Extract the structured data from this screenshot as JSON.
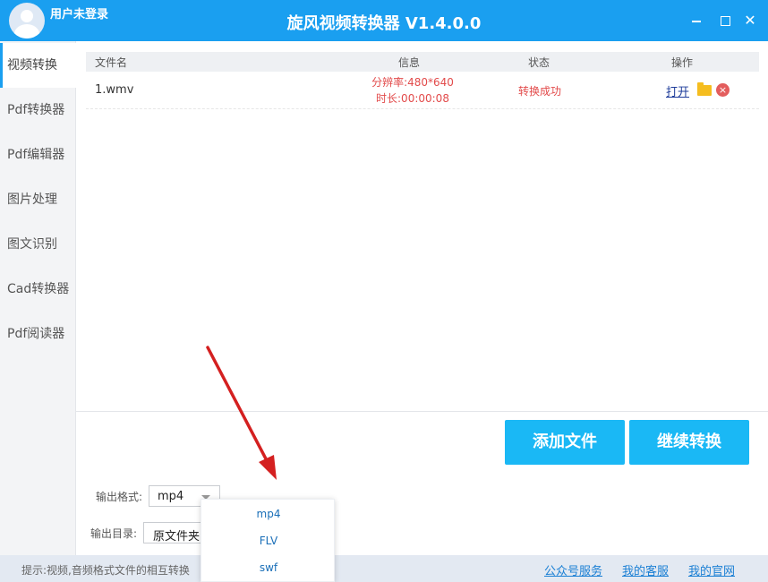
{
  "titlebar": {
    "user_label": "用户未登录",
    "app_title": "旋风视频转换器 V1.4.0.0",
    "close_glyph": "✕"
  },
  "sidebar": {
    "items": [
      {
        "label": "视频转换",
        "active": true
      },
      {
        "label": "Pdf转换器"
      },
      {
        "label": "Pdf编辑器"
      },
      {
        "label": "图片处理"
      },
      {
        "label": "图文识别"
      },
      {
        "label": "Cad转换器"
      },
      {
        "label": "Pdf阅读器"
      }
    ]
  },
  "table": {
    "headers": {
      "name": "文件名",
      "info": "信息",
      "status": "状态",
      "action": "操作"
    },
    "rows": [
      {
        "name": "1.wmv",
        "resolution": "分辨率:480*640",
        "duration": "时长:00:00:08",
        "status": "转换成功",
        "open_label": "打开"
      }
    ]
  },
  "buttons": {
    "add_file": "添加文件",
    "continue": "继续转换"
  },
  "output": {
    "format_label": "输出格式:",
    "format_value": "mp4",
    "dir_label": "输出目录:",
    "dir_value": "原文件夹"
  },
  "dropdown": {
    "options": [
      "mp4",
      "FLV",
      "swf"
    ]
  },
  "statusbar": {
    "tip": "提示:视频,音频格式文件的相互转换",
    "links": [
      "公众号服务",
      "我的客服",
      "我的官网"
    ]
  },
  "colors": {
    "accent": "#1a9ff0",
    "button": "#1ab8f5",
    "error_text": "#e24a4a",
    "annotation_arrow": "#d42020"
  }
}
